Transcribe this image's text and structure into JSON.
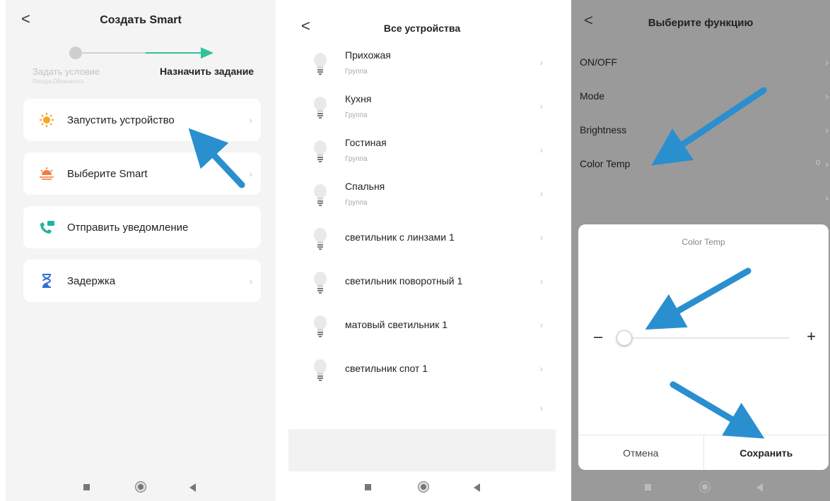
{
  "colors": {
    "accent_green": "#2fc39a",
    "callout_blue": "#2a8fcf"
  },
  "screen1": {
    "title": "Создать Smart",
    "step_condition": "Задать условие",
    "step_condition_sub": "Погода:Облачность",
    "step_task": "Назначить задание",
    "actions": [
      {
        "label": "Запустить устройство",
        "icon": "sun-icon"
      },
      {
        "label": "Выберите Smart",
        "icon": "sunrise-icon"
      },
      {
        "label": "Отправить уведомление",
        "icon": "phone-message-icon"
      },
      {
        "label": "Задержка",
        "icon": "hourglass-icon"
      }
    ]
  },
  "screen2": {
    "title": "Все устройства",
    "devices": [
      {
        "name": "Прихожая",
        "sub": "Группа"
      },
      {
        "name": "Кухня",
        "sub": "Группа"
      },
      {
        "name": "Гостиная",
        "sub": "Группа"
      },
      {
        "name": "Спальня",
        "sub": "Группа"
      },
      {
        "name": "светильник с линзами 1"
      },
      {
        "name": "светильник поворотный 1"
      },
      {
        "name": "матовый светильник 1"
      },
      {
        "name": "светильник спот 1"
      }
    ]
  },
  "screen3": {
    "title": "Выберите функцию",
    "functions": [
      {
        "label": "ON/OFF"
      },
      {
        "label": "Mode"
      },
      {
        "label": "Brightness"
      },
      {
        "label": "Color Temp",
        "value": "0"
      }
    ],
    "dialog": {
      "title": "Color Temp",
      "minus": "–",
      "plus": "+",
      "slider_value_fraction": 0,
      "cancel": "Отмена",
      "save": "Сохранить"
    }
  },
  "nav": {
    "back": "<"
  }
}
